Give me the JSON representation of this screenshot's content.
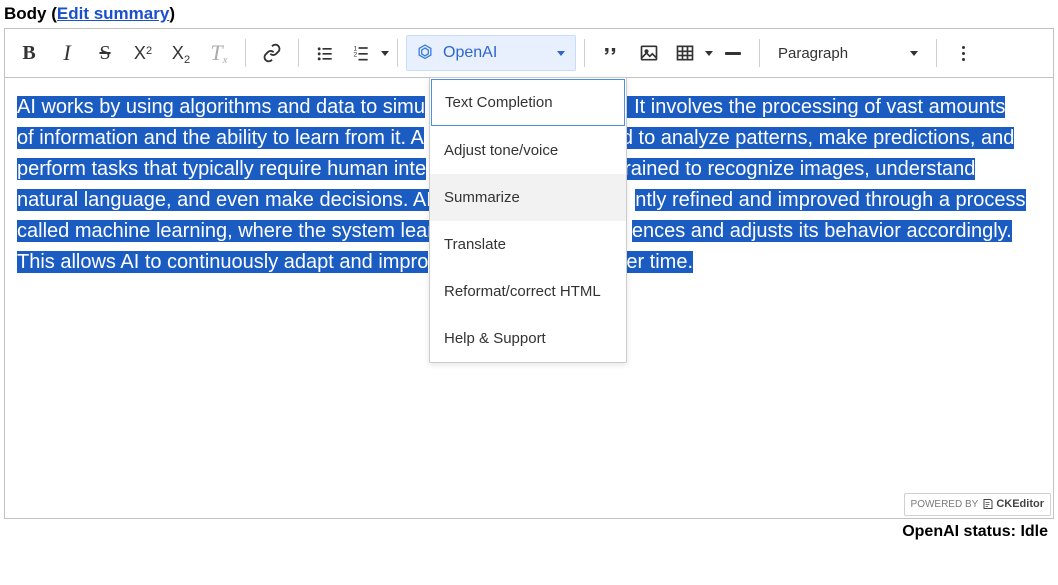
{
  "field": {
    "label_prefix": "Body (",
    "edit_summary": "Edit summary",
    "label_suffix": ")"
  },
  "toolbar": {
    "openai_label": "OpenAI",
    "paragraph_label": "Paragraph"
  },
  "dropdown": {
    "items": [
      "Text Completion",
      "Adjust tone/voice",
      "Summarize",
      "Translate",
      "Reformat/correct HTML",
      "Help & Support"
    ]
  },
  "content": {
    "p1_a": "AI works by using algorithms and data to simu",
    "p1_b": ". It involves the processing of vast amounts",
    "p2": "of information and the ability to learn from it. A",
    "p2_b": "d to analyze patterns, make predictions, and",
    "p3": "perform tasks that typically require human inte",
    "p3_b": "rained to recognize images, understand",
    "p4": "natural language, and even make decisions. AI ",
    "p4_b": "ntly refined and improved through a process",
    "p5": "called machine learning, where the system lear",
    "p5_b": "ences and adjusts its behavior accordingly.",
    "p6": "This allows AI to continuously adapt and impro",
    "p6_b": "er time."
  },
  "status": {
    "text": "OpenAI status: Idle"
  },
  "powered": {
    "label": "POWERED BY",
    "name": "CKEditor"
  }
}
